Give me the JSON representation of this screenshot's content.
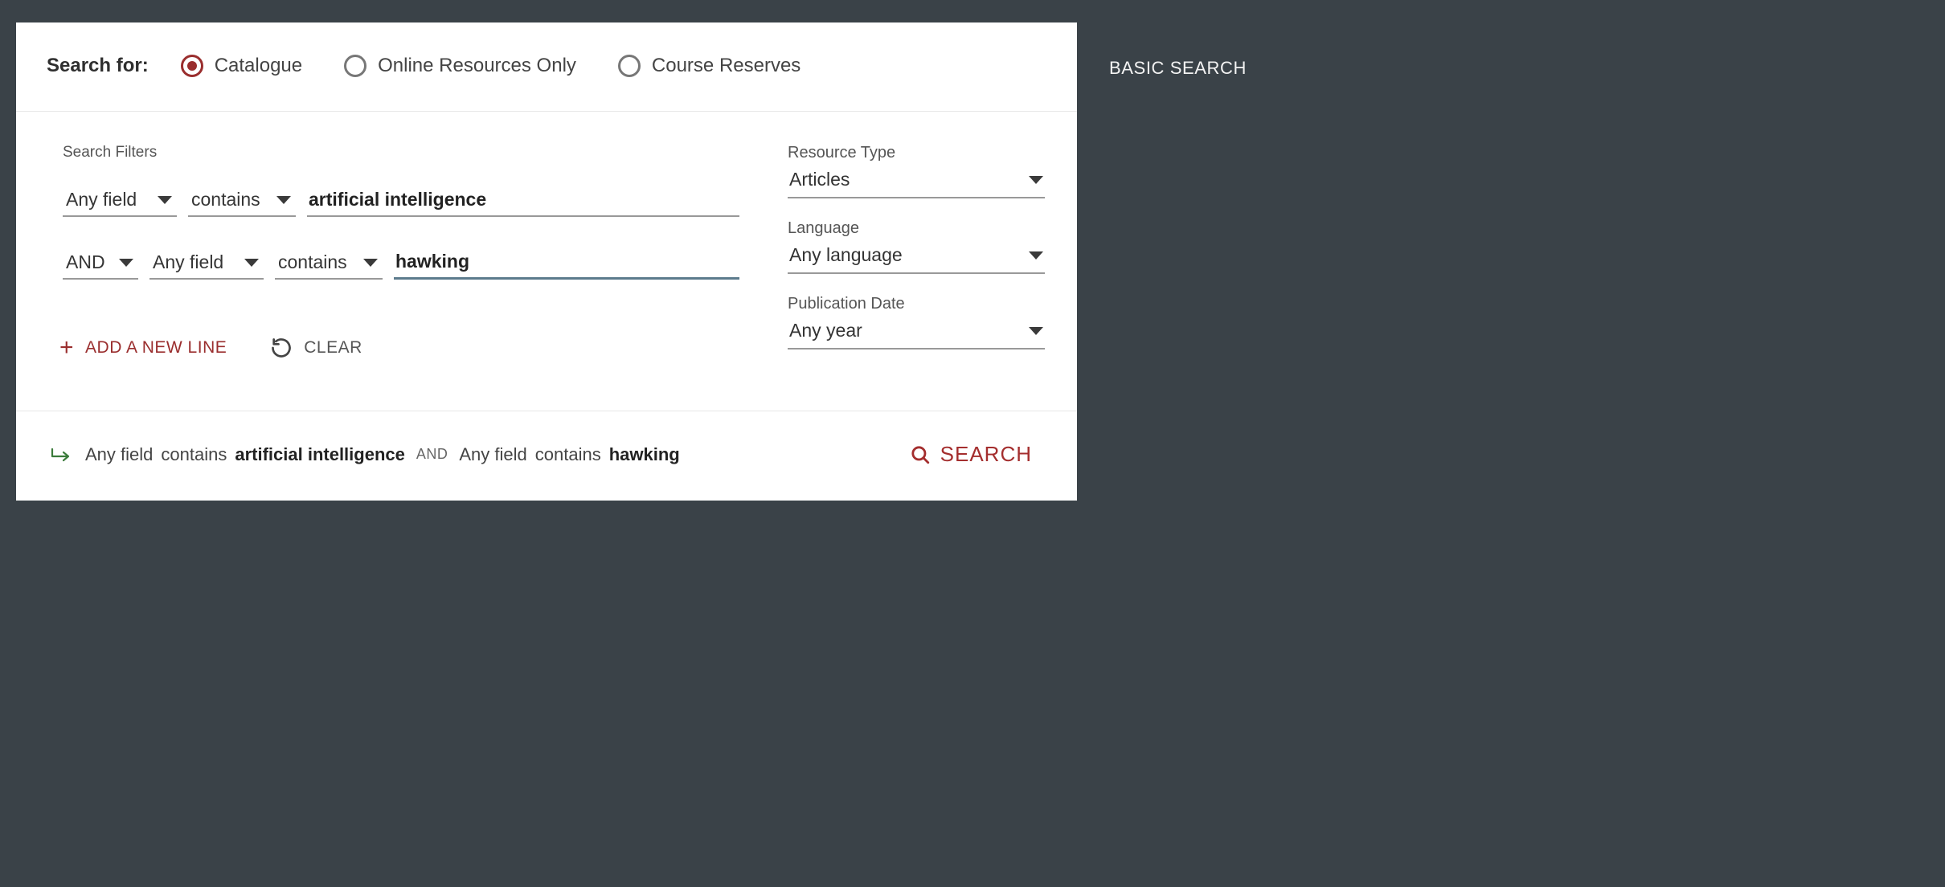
{
  "header": {
    "search_for_label": "Search for:",
    "radios": {
      "catalogue": "Catalogue",
      "online": "Online Resources Only",
      "reserves": "Course Reserves",
      "selected": "catalogue"
    }
  },
  "filters": {
    "title": "Search Filters",
    "row1": {
      "field": "Any field",
      "op": "contains",
      "value": "artificial intelligence"
    },
    "row2": {
      "bool": "AND",
      "field": "Any field",
      "op": "contains",
      "value": "hawking"
    },
    "add_line": "ADD A NEW LINE",
    "clear": "CLEAR"
  },
  "side": {
    "resource_type": {
      "label": "Resource Type",
      "value": "Articles"
    },
    "language": {
      "label": "Language",
      "value": "Any language"
    },
    "pub_date": {
      "label": "Publication Date",
      "value": "Any year"
    }
  },
  "footer": {
    "s1_field": "Any field",
    "s1_op": "contains",
    "s1_val": "artificial intelligence",
    "and": "AND",
    "s2_field": "Any field",
    "s2_op": "contains",
    "s2_val": "hawking",
    "search": "SEARCH"
  },
  "side_link": "BASIC SEARCH"
}
